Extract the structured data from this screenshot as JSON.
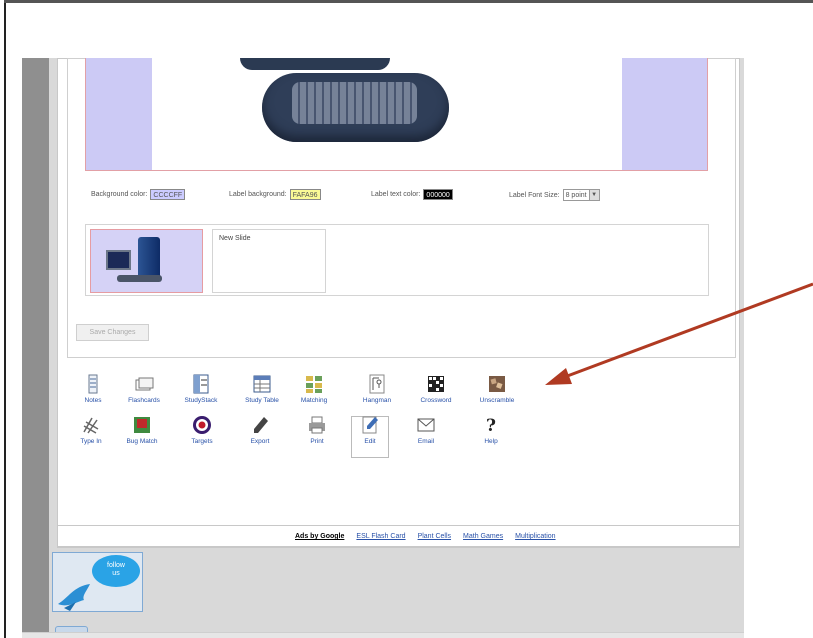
{
  "slide_editor": {
    "background_color_label": "Background color:",
    "background_color_value": "CCCCFF",
    "label_background_label": "Label background:",
    "label_background_value": "FAFA96",
    "label_text_color_label": "Label text color:",
    "label_text_color_value": "000000",
    "label_font_size_label": "Label Font Size:",
    "label_font_size_value": "8 point",
    "slide_label": "New Slide",
    "save_button": "Save Changes"
  },
  "toolbar": {
    "row1": [
      {
        "id": "notes",
        "label": "Notes",
        "icon": "notes-icon"
      },
      {
        "id": "flashcards",
        "label": "Flashcards",
        "icon": "flashcards-icon"
      },
      {
        "id": "studystack",
        "label": "StudyStack",
        "icon": "studystack-icon"
      },
      {
        "id": "study-table",
        "label": "Study Table",
        "icon": "study-table-icon"
      },
      {
        "id": "matching",
        "label": "Matching",
        "icon": "matching-icon"
      },
      {
        "id": "hangman",
        "label": "Hangman",
        "icon": "hangman-icon"
      },
      {
        "id": "crossword",
        "label": "Crossword",
        "icon": "crossword-icon"
      },
      {
        "id": "unscramble",
        "label": "Unscramble",
        "icon": "unscramble-icon"
      }
    ],
    "row2": [
      {
        "id": "type-in",
        "label": "Type In",
        "icon": "type-in-icon"
      },
      {
        "id": "bug-match",
        "label": "Bug Match",
        "icon": "bug-match-icon"
      },
      {
        "id": "targets",
        "label": "Targets",
        "icon": "target-icon"
      },
      {
        "id": "export",
        "label": "Export",
        "icon": "pencil-icon"
      },
      {
        "id": "print",
        "label": "Print",
        "icon": "printer-icon"
      },
      {
        "id": "edit",
        "label": "Edit",
        "icon": "edit-icon"
      },
      {
        "id": "email",
        "label": "Email",
        "icon": "envelope-icon"
      },
      {
        "id": "help",
        "label": "Help",
        "icon": "question-icon"
      }
    ]
  },
  "ads": {
    "label": "Ads by Google",
    "links": [
      "ESL Flash Card",
      "Plant Cells",
      "Math Games",
      "Multiplication"
    ]
  },
  "follow": {
    "line1": "follow",
    "line2": "us"
  },
  "colors": {
    "arrow": "#b03a22",
    "link": "#2851a8",
    "swatch_bg": "#ccccff",
    "swatch_label": "#fafa96",
    "swatch_text": "#000000"
  }
}
